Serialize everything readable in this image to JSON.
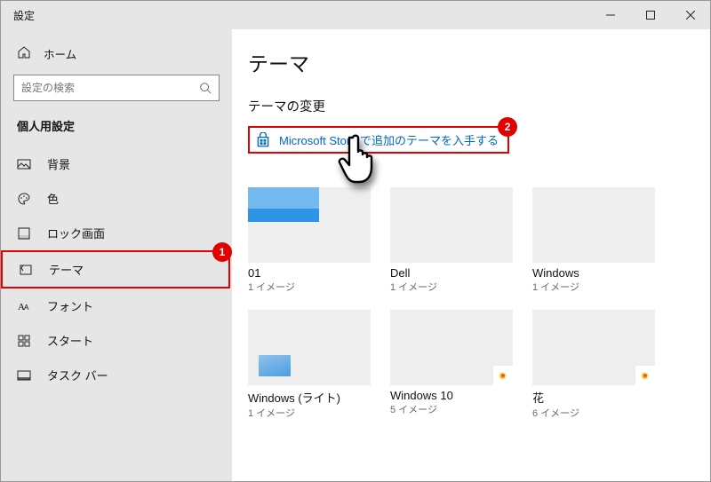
{
  "window": {
    "title": "設定"
  },
  "sidebar": {
    "home_label": "ホーム",
    "search_placeholder": "設定の検索",
    "category_label": "個人用設定",
    "items": [
      {
        "label": "背景"
      },
      {
        "label": "色"
      },
      {
        "label": "ロック画面"
      },
      {
        "label": "テーマ"
      },
      {
        "label": "フォント"
      },
      {
        "label": "スタート"
      },
      {
        "label": "タスク バー"
      }
    ]
  },
  "main": {
    "heading": "テーマ",
    "subheading": "テーマの変更",
    "store_link_label": "Microsoft Store で追加のテーマを入手する"
  },
  "themes": [
    {
      "name": "01",
      "sub": "1 イメージ"
    },
    {
      "name": "Dell",
      "sub": "1 イメージ"
    },
    {
      "name": "Windows",
      "sub": "1 イメージ"
    },
    {
      "name": "Windows (ライト)",
      "sub": "1 イメージ"
    },
    {
      "name": "Windows 10",
      "sub": "5 イメージ"
    },
    {
      "name": "花",
      "sub": "6 イメージ"
    }
  ],
  "annotations": {
    "badge1": "1",
    "badge2": "2"
  }
}
